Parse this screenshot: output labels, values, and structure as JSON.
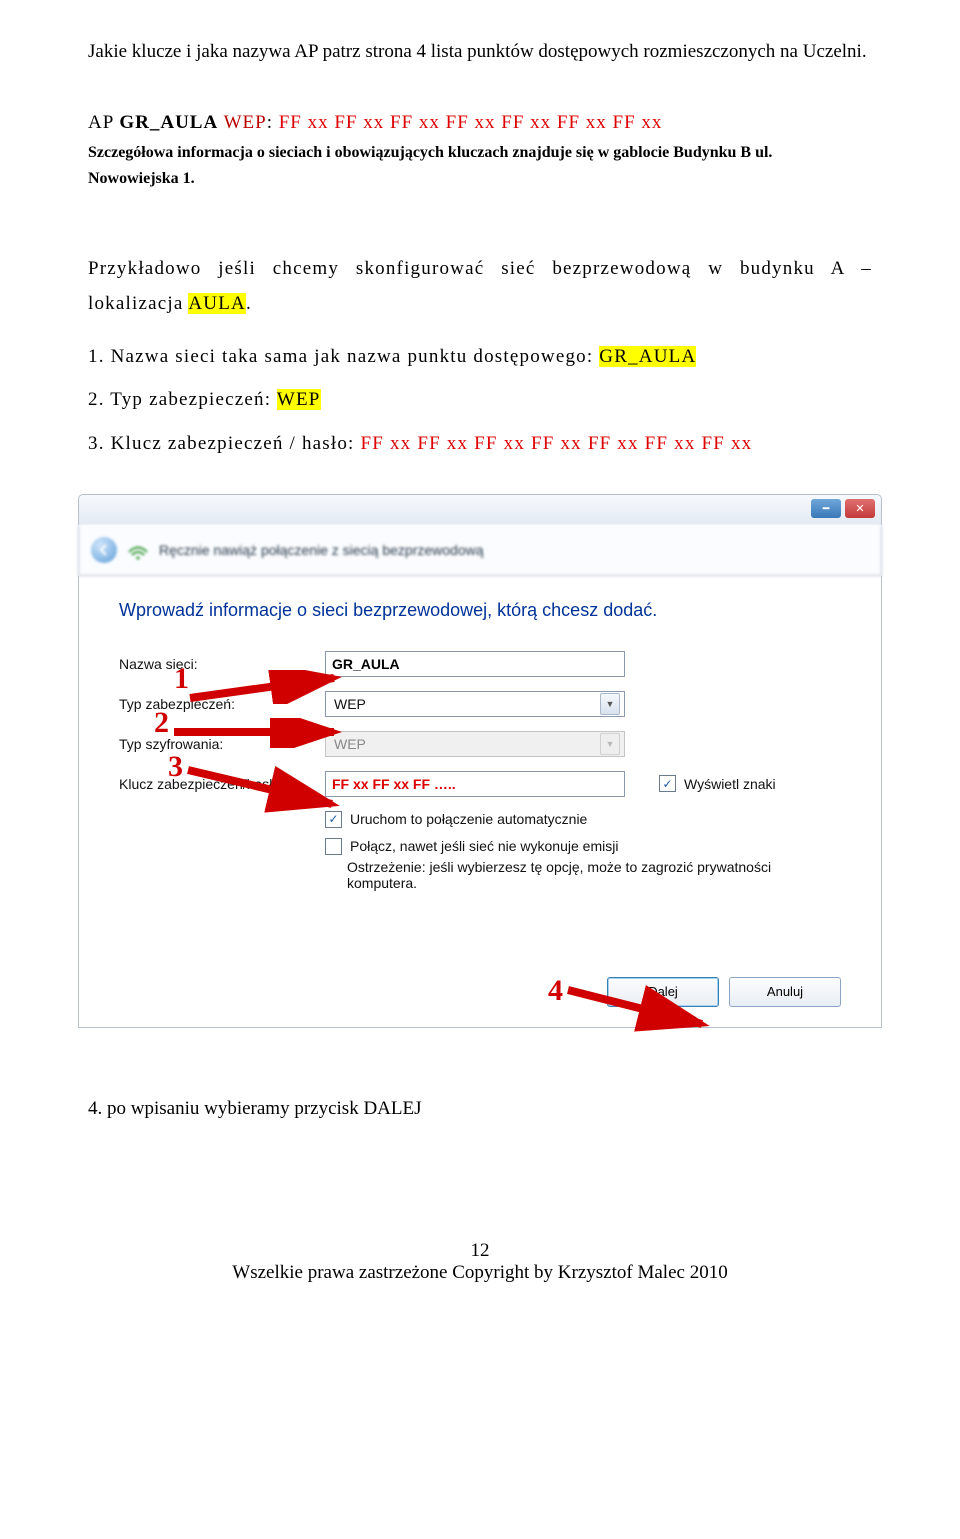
{
  "intro": "Jakie klucze i jaka nazywa AP patrz strona 4 lista punktów dostępowych rozmieszczonych na Uczelni.",
  "ap_line": {
    "prefix": "AP ",
    "name": "GR_AULA",
    "wep_label": " WEP",
    "colon": ": ",
    "key": "FF xx FF xx FF xx FF xx FF xx FF xx FF xx"
  },
  "detail1": "Szczegółowa informacja o sieciach i obowiązujących kluczach znajduje się w gablocie Budynku B ul.",
  "detail2": "Nowowiejska 1.",
  "example": {
    "pre": "Przykładowo jeśli chcemy skonfigurować sieć bezprzewodową w budynku A – lokalizacja ",
    "hl": "AULA",
    "post": "."
  },
  "items": {
    "i1_pre": "1. Nazwa sieci taka sama jak nazwa punktu dostępowego: ",
    "i1_hl": "GR_AULA",
    "i2_pre": "2. Typ zabezpieczeń: ",
    "i2_hl": "WEP",
    "i3_pre": "3. Klucz zabezpieczeń / hasło: ",
    "i3_red": "FF xx FF xx FF xx FF xx FF xx FF xx FF xx"
  },
  "win": {
    "breadcrumb": "Ręcznie nawiąż połączenie z siecią bezprzewodową",
    "title": "Wprowadź informacje o sieci bezprzewodowej, którą chcesz dodać.",
    "labels": {
      "ssid": "Nazwa sieci:",
      "sec": "Typ zabezpieczeń:",
      "enc": "Typ szyfrowania:",
      "key": "Klucz zabezpieczeń/hasł"
    },
    "values": {
      "ssid": "GR_AULA",
      "sec": "WEP",
      "enc": "WEP",
      "key": "FF xx FF xx FF ….."
    },
    "show_chars": "Wyświetl znaki",
    "auto_start": "Uruchom to połączenie automatycznie",
    "connect_hidden": "Połącz, nawet jeśli sieć nie wykonuje emisji",
    "warn": "Ostrzeżenie: jeśli wybierzesz tę opcję, może to zagrozić prywatności komputera.",
    "buttons": {
      "next": "Dalej",
      "cancel": "Anuluj"
    }
  },
  "overlay_numbers": {
    "n1": "1",
    "n2": "2",
    "n3": "3",
    "n4": "4"
  },
  "after": "4. po wpisaniu wybieramy przycisk DALEJ",
  "footer": {
    "page": "12",
    "copy": "Wszelkie prawa zastrzeżone Copyright by Krzysztof Malec  2010"
  }
}
